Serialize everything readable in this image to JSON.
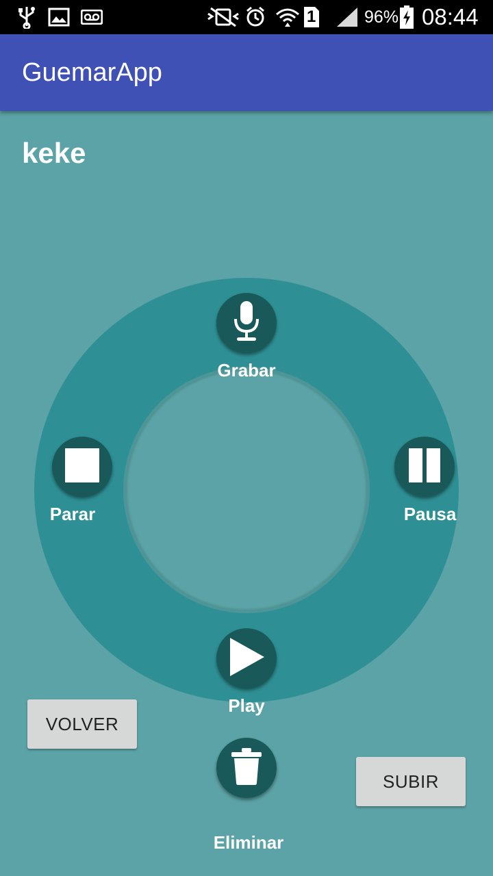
{
  "status_bar": {
    "battery": "96%",
    "time": "08:44",
    "sim_slot": "1",
    "icons": [
      "usb-icon",
      "gallery-icon",
      "voicemail-icon",
      "mute-vibrate-icon",
      "alarm-icon",
      "wifi-icon",
      "sim-icon",
      "signal-icon",
      "battery-charging-icon"
    ]
  },
  "app_bar": {
    "title": "GuemarApp"
  },
  "recording": {
    "name": "keke"
  },
  "controls": {
    "record": {
      "label": "Grabar",
      "icon": "microphone-icon"
    },
    "stop": {
      "label": "Parar",
      "icon": "stop-icon"
    },
    "pause": {
      "label": "Pausa",
      "icon": "pause-icon"
    },
    "play": {
      "label": "Play",
      "icon": "play-icon"
    },
    "delete": {
      "label": "Eliminar",
      "icon": "trash-icon"
    }
  },
  "buttons": {
    "back": "VOLVER",
    "upload": "SUBIR"
  },
  "colors": {
    "app_bar": "#3f51b5",
    "background": "#5ba3a6",
    "ring": "#2e9094",
    "fab": "#1a5959",
    "button": "#d6d7d7"
  }
}
